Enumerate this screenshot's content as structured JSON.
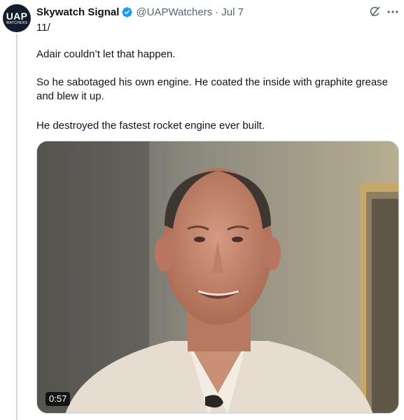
{
  "author": {
    "avatar_text": "UAP",
    "avatar_subtext": "WATCHERS",
    "display_name": "Skywatch Signal",
    "handle": "@UAPWatchers",
    "separator": "·",
    "date": "Jul 7",
    "verified_color": "#1d9bf0"
  },
  "tweet": {
    "thread_number": "11/",
    "paragraphs": [
      "Adair couldn’t let that happen.",
      "So he sabotaged his own engine. He coated the inside with graphite grease and blew it up.",
      "He destroyed the fastest rocket engine ever built."
    ]
  },
  "media": {
    "type": "video",
    "duration": "0:57"
  },
  "icons": {
    "grok": "grok-icon",
    "more": "more-horizontal-icon",
    "verified": "verified-badge-icon"
  }
}
